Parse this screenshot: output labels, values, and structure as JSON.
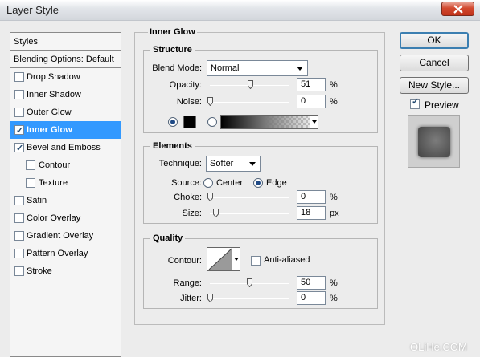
{
  "window": {
    "title": "Layer Style"
  },
  "styles": {
    "header": "Styles",
    "blending": "Blending Options: Default",
    "items": [
      {
        "label": "Drop Shadow",
        "checked": false,
        "selected": false,
        "sub": false
      },
      {
        "label": "Inner Shadow",
        "checked": false,
        "selected": false,
        "sub": false
      },
      {
        "label": "Outer Glow",
        "checked": false,
        "selected": false,
        "sub": false
      },
      {
        "label": "Inner Glow",
        "checked": true,
        "selected": true,
        "sub": false
      },
      {
        "label": "Bevel and Emboss",
        "checked": true,
        "selected": false,
        "sub": false
      },
      {
        "label": "Contour",
        "checked": false,
        "selected": false,
        "sub": true
      },
      {
        "label": "Texture",
        "checked": false,
        "selected": false,
        "sub": true
      },
      {
        "label": "Satin",
        "checked": false,
        "selected": false,
        "sub": false
      },
      {
        "label": "Color Overlay",
        "checked": false,
        "selected": false,
        "sub": false
      },
      {
        "label": "Gradient Overlay",
        "checked": false,
        "selected": false,
        "sub": false
      },
      {
        "label": "Pattern Overlay",
        "checked": false,
        "selected": false,
        "sub": false
      },
      {
        "label": "Stroke",
        "checked": false,
        "selected": false,
        "sub": false
      }
    ]
  },
  "inner_glow": {
    "heading": "Inner Glow",
    "structure": {
      "legend": "Structure",
      "blend_mode_label": "Blend Mode:",
      "blend_mode_value": "Normal",
      "opacity_label": "Opacity:",
      "opacity_value": "51",
      "opacity_level": 0.51,
      "opacity_unit": "%",
      "noise_label": "Noise:",
      "noise_value": "0",
      "noise_level": 0,
      "noise_unit": "%",
      "glow_color": "#000000"
    },
    "elements": {
      "legend": "Elements",
      "technique_label": "Technique:",
      "technique_value": "Softer",
      "source_label": "Source:",
      "source_center": "Center",
      "source_edge": "Edge",
      "choke_label": "Choke:",
      "choke_value": "0",
      "choke_level": 0,
      "choke_unit": "%",
      "size_label": "Size:",
      "size_value": "18",
      "size_level": 0.07,
      "size_unit": "px"
    },
    "quality": {
      "legend": "Quality",
      "contour_label": "Contour:",
      "anti_aliased_label": "Anti-aliased",
      "range_label": "Range:",
      "range_value": "50",
      "range_level": 0.5,
      "range_unit": "%",
      "jitter_label": "Jitter:",
      "jitter_value": "0",
      "jitter_level": 0,
      "jitter_unit": "%"
    }
  },
  "actions": {
    "ok": "OK",
    "cancel": "Cancel",
    "new_style": "New Style...",
    "preview_label": "Preview",
    "preview_checked": true
  },
  "watermark": "OLiHe.COM"
}
